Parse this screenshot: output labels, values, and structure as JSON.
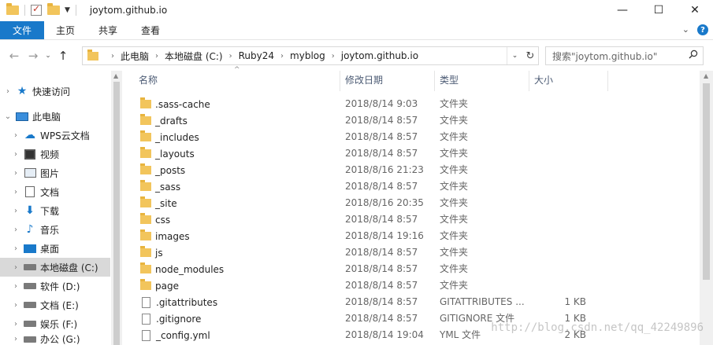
{
  "window": {
    "title": "joytom.github.io",
    "minimize_glyph": "—",
    "maximize_glyph": "☐",
    "close_glyph": "✕"
  },
  "ribbon": {
    "file": "文件",
    "tabs": [
      "主页",
      "共享",
      "查看"
    ]
  },
  "address": {
    "crumbs": [
      "此电脑",
      "本地磁盘 (C:)",
      "Ruby24",
      "myblog",
      "joytom.github.io"
    ],
    "search_placeholder": "搜索\"joytom.github.io\""
  },
  "nav": {
    "items": [
      {
        "label": "快速访问",
        "icon": "star-icon"
      },
      {
        "label": "此电脑",
        "icon": "computer-icon"
      },
      {
        "label": "WPS云文档",
        "icon": "cloud-icon"
      },
      {
        "label": "视频",
        "icon": "video-icon"
      },
      {
        "label": "图片",
        "icon": "picture-icon"
      },
      {
        "label": "文档",
        "icon": "document-icon"
      },
      {
        "label": "下载",
        "icon": "download-icon"
      },
      {
        "label": "音乐",
        "icon": "music-icon"
      },
      {
        "label": "桌面",
        "icon": "desktop-icon"
      },
      {
        "label": "本地磁盘 (C:)",
        "icon": "drive-icon"
      },
      {
        "label": "软件 (D:)",
        "icon": "drive-icon"
      },
      {
        "label": "文档 (E:)",
        "icon": "drive-icon"
      },
      {
        "label": "娱乐 (F:)",
        "icon": "drive-icon"
      },
      {
        "label": "办公 (G:)",
        "icon": "drive-icon"
      }
    ],
    "selected": "本地磁盘 (C:)"
  },
  "columns": {
    "name": "名称",
    "date": "修改日期",
    "type": "类型",
    "size": "大小"
  },
  "files": [
    {
      "name": ".sass-cache",
      "date": "2018/8/14 9:03",
      "type": "文件夹",
      "size": "",
      "kind": "folder"
    },
    {
      "name": "_drafts",
      "date": "2018/8/14 8:57",
      "type": "文件夹",
      "size": "",
      "kind": "folder"
    },
    {
      "name": "_includes",
      "date": "2018/8/14 8:57",
      "type": "文件夹",
      "size": "",
      "kind": "folder"
    },
    {
      "name": "_layouts",
      "date": "2018/8/14 8:57",
      "type": "文件夹",
      "size": "",
      "kind": "folder"
    },
    {
      "name": "_posts",
      "date": "2018/8/16 21:23",
      "type": "文件夹",
      "size": "",
      "kind": "folder"
    },
    {
      "name": "_sass",
      "date": "2018/8/14 8:57",
      "type": "文件夹",
      "size": "",
      "kind": "folder"
    },
    {
      "name": "_site",
      "date": "2018/8/16 20:35",
      "type": "文件夹",
      "size": "",
      "kind": "folder"
    },
    {
      "name": "css",
      "date": "2018/8/14 8:57",
      "type": "文件夹",
      "size": "",
      "kind": "folder"
    },
    {
      "name": "images",
      "date": "2018/8/14 19:16",
      "type": "文件夹",
      "size": "",
      "kind": "folder"
    },
    {
      "name": "js",
      "date": "2018/8/14 8:57",
      "type": "文件夹",
      "size": "",
      "kind": "folder"
    },
    {
      "name": "node_modules",
      "date": "2018/8/14 8:57",
      "type": "文件夹",
      "size": "",
      "kind": "folder"
    },
    {
      "name": "page",
      "date": "2018/8/14 8:57",
      "type": "文件夹",
      "size": "",
      "kind": "folder"
    },
    {
      "name": ".gitattributes",
      "date": "2018/8/14 8:57",
      "type": "GITATTRIBUTES ...",
      "size": "1 KB",
      "kind": "file"
    },
    {
      "name": ".gitignore",
      "date": "2018/8/14 8:57",
      "type": "GITIGNORE 文件",
      "size": "1 KB",
      "kind": "file"
    },
    {
      "name": "_config.yml",
      "date": "2018/8/14 19:04",
      "type": "YML 文件",
      "size": "2 KB",
      "kind": "file"
    }
  ],
  "watermark": "http://blog.csdn.net/qq_42249896",
  "colors": {
    "accent": "#1979ca",
    "folder": "#f2c55c",
    "selected_bg": "#d9d9d9"
  }
}
